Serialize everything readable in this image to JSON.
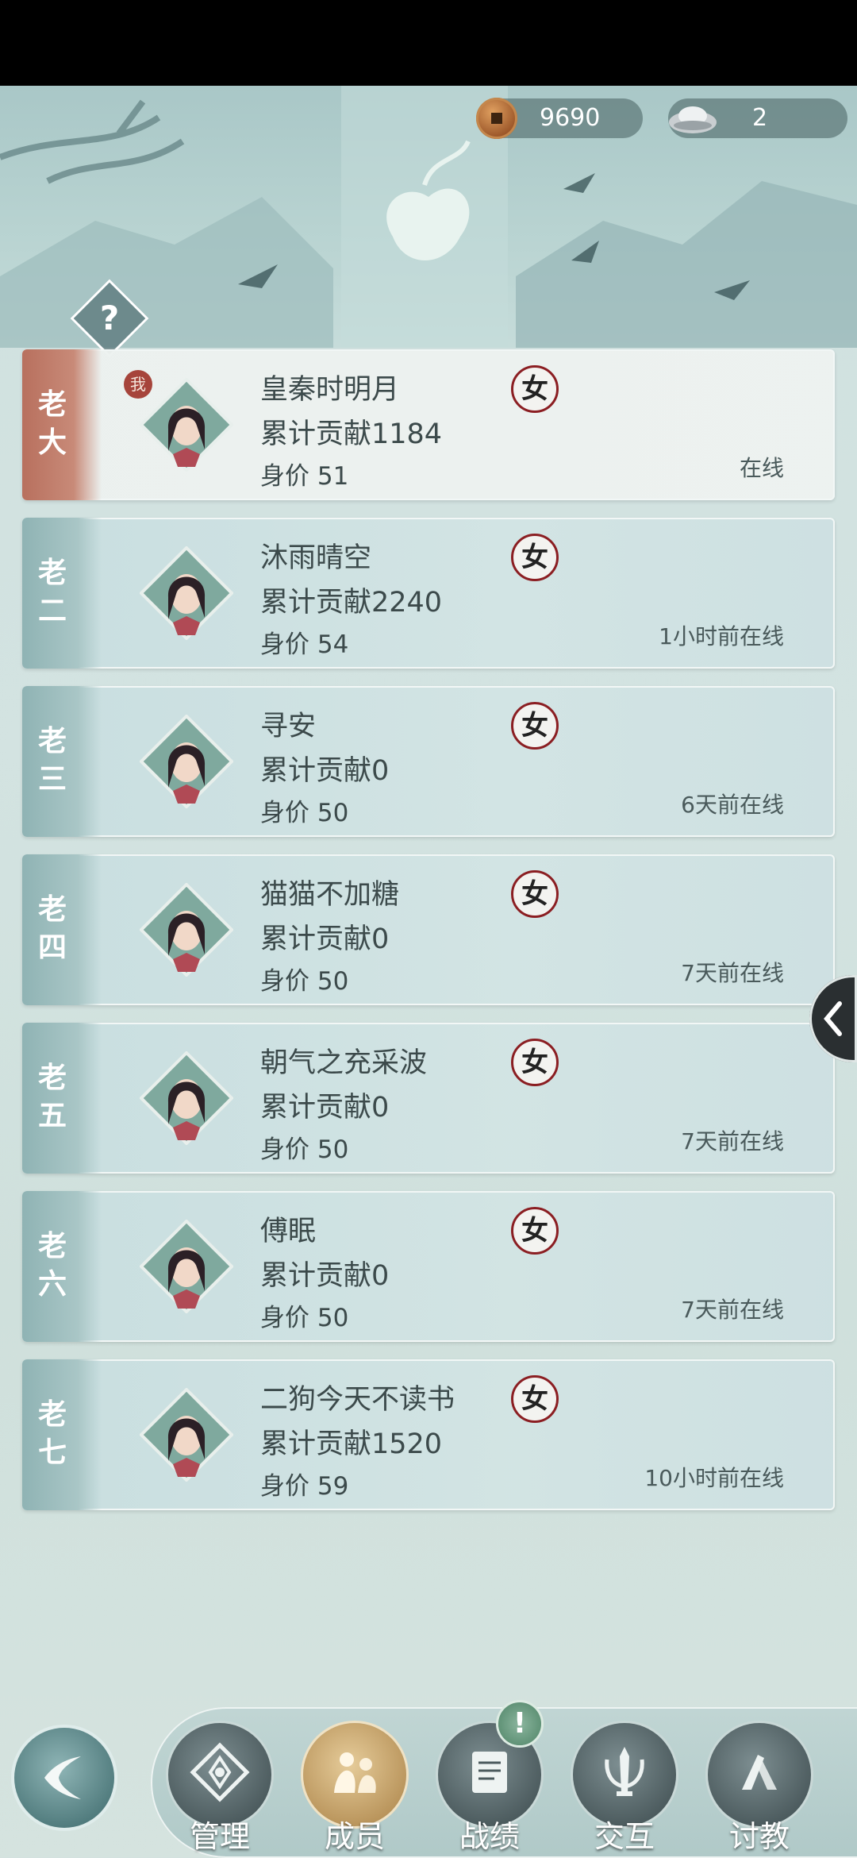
{
  "currency": {
    "coins": "9690",
    "ingots": "2",
    "coin_icon": "copper-coin-icon",
    "ingot_icon": "silver-ingot-icon"
  },
  "help": {
    "label": "?"
  },
  "members": [
    {
      "rank": "老大",
      "name": "皇秦时明月",
      "contribution": "累计贡献1184",
      "worth": "身价 51",
      "status": "在线",
      "gender": "女",
      "self": true,
      "self_badge": "我"
    },
    {
      "rank": "老二",
      "name": "沐雨晴空",
      "contribution": "累计贡献2240",
      "worth": "身价 54",
      "status": "1小时前在线",
      "gender": "女"
    },
    {
      "rank": "老三",
      "name": "寻安",
      "contribution": "累计贡献0",
      "worth": "身价 50",
      "status": "6天前在线",
      "gender": "女"
    },
    {
      "rank": "老四",
      "name": "猫猫不加糖",
      "contribution": "累计贡献0",
      "worth": "身价 50",
      "status": "7天前在线",
      "gender": "女"
    },
    {
      "rank": "老五",
      "name": "朝气之充采波",
      "contribution": "累计贡献0",
      "worth": "身价 50",
      "status": "7天前在线",
      "gender": "女"
    },
    {
      "rank": "老六",
      "name": "傅眠",
      "contribution": "累计贡献0",
      "worth": "身价 50",
      "status": "7天前在线",
      "gender": "女"
    },
    {
      "rank": "老七",
      "name": "二狗今天不读书",
      "contribution": "累计贡献1520",
      "worth": "身价 59",
      "status": "10小时前在线",
      "gender": "女"
    }
  ],
  "nav": {
    "manage": "管理",
    "members": "成员",
    "records": "战绩",
    "interact": "交互",
    "teach": "讨教",
    "alert": "!"
  },
  "colors": {
    "accent_self": "#b8705e",
    "gender_ring": "#8b1e22",
    "active_nav": "#c9a76a"
  }
}
